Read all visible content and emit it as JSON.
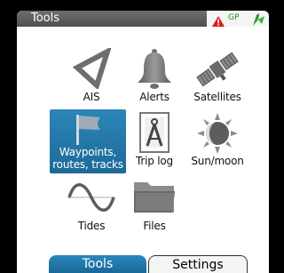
{
  "window": {
    "title": "Tools"
  },
  "status": {
    "gps_label": "GP"
  },
  "tiles": [
    {
      "label": "AIS"
    },
    {
      "label": "Alerts"
    },
    {
      "label": "Satellites"
    },
    {
      "label": "Waypoints,\nroutes, tracks",
      "line1": "Waypoints,",
      "line2": "routes, tracks",
      "selected": true
    },
    {
      "label": "Trip log"
    },
    {
      "label": "Sun/moon"
    },
    {
      "label": "Tides"
    },
    {
      "label": "Files"
    }
  ],
  "tabs": [
    {
      "label": "Tools",
      "active": true
    },
    {
      "label": "Settings",
      "active": false
    }
  ],
  "colors": {
    "accent": "#1f77ad",
    "alarm": "#d81e1e",
    "gps": "#1a8f1a"
  },
  "icons": [
    "ais-icon",
    "bell-icon",
    "satellite-icon",
    "flag-icon",
    "compass-divider-icon",
    "sun-moon-icon",
    "sine-wave-icon",
    "folder-icon"
  ]
}
